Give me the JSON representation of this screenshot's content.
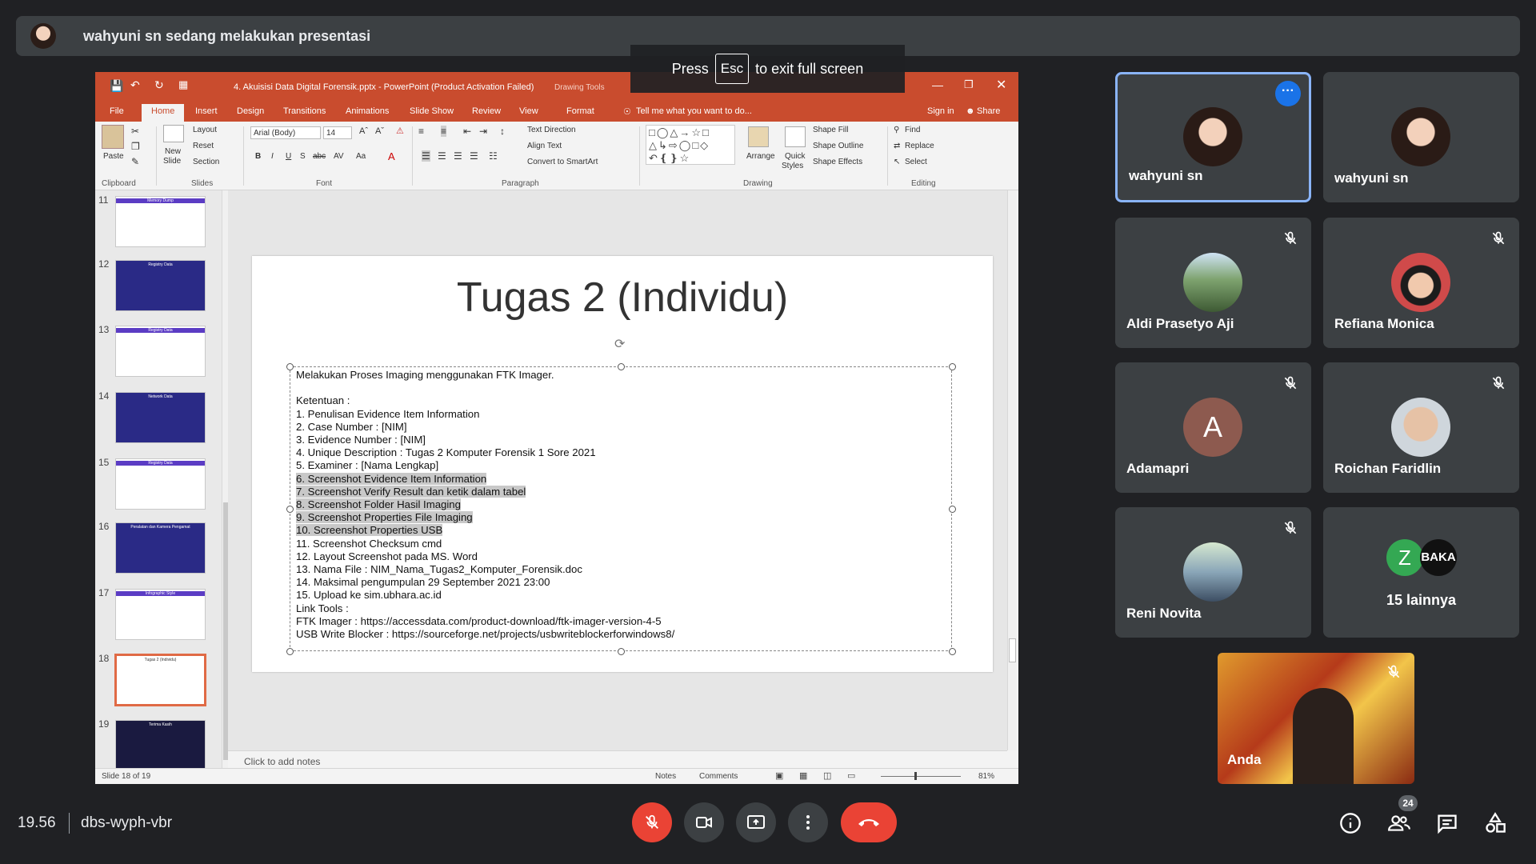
{
  "banner": {
    "text": "wahyuni sn sedang melakukan presentasi"
  },
  "esc_overlay": {
    "press": "Press",
    "key": "Esc",
    "suffix": "to exit full screen"
  },
  "ppt": {
    "window_title": "4. Akuisisi Data Digital Forensik.pptx - PowerPoint (Product Activation Failed)",
    "context_tab_title": "Drawing Tools",
    "tabs": [
      "File",
      "Home",
      "Insert",
      "Design",
      "Transitions",
      "Animations",
      "Slide Show",
      "Review",
      "View",
      "Format"
    ],
    "tell_me": "Tell me what you want to do...",
    "sign_in": "Sign in",
    "share": "Share",
    "ribbon": {
      "paste": "Paste",
      "clipboard": "Clipboard",
      "new_slide_1": "New",
      "new_slide_2": "Slide",
      "layout": "Layout",
      "reset": "Reset",
      "section": "Section",
      "slides": "Slides",
      "font_name": "Arial (Body)",
      "font_size": "14",
      "font": "Font",
      "text_direction": "Text Direction",
      "align_text": "Align Text",
      "convert_smartart": "Convert to SmartArt",
      "paragraph": "Paragraph",
      "arrange": "Arrange",
      "quick_styles_1": "Quick",
      "quick_styles_2": "Styles",
      "shape_fill": "Shape Fill",
      "shape_outline": "Shape Outline",
      "shape_effects": "Shape Effects",
      "drawing": "Drawing",
      "find": "Find",
      "replace": "Replace",
      "select": "Select",
      "editing": "Editing"
    },
    "thumbnails": [
      {
        "num": "11",
        "caption": "Memory Dump",
        "bg": "#ffffff"
      },
      {
        "num": "12",
        "caption": "Registry Data",
        "bg": "#2a2a86"
      },
      {
        "num": "13",
        "caption": "Registry Data",
        "bg": "#ffffff"
      },
      {
        "num": "14",
        "caption": "Network Data",
        "bg": "#2a2a86"
      },
      {
        "num": "15",
        "caption": "Registry Data",
        "bg": "#ffffff"
      },
      {
        "num": "16",
        "caption": "Peralatan dan Kamera Pengamat",
        "bg": "#2a2a86"
      },
      {
        "num": "17",
        "caption": "Infographic Style",
        "bg": "#ffffff"
      },
      {
        "num": "18",
        "caption": "Tugas 2 (Individu)",
        "bg": "#ffffff"
      },
      {
        "num": "19",
        "caption": "Terima Kasih",
        "bg": "#1a1a40"
      }
    ],
    "slide": {
      "title": "Tugas 2 (Individu)",
      "lines": [
        {
          "text": "Melakukan Proses Imaging menggunakan FTK Imager.",
          "hl": false
        },
        {
          "text": "",
          "hl": false
        },
        {
          "text": "Ketentuan :",
          "hl": false
        },
        {
          "text": "1.    Penulisan Evidence Item Information",
          "hl": false
        },
        {
          "text": "2.    Case Number : [NIM]",
          "hl": false
        },
        {
          "text": "3.    Evidence Number : [NIM]",
          "hl": false
        },
        {
          "text": "4.    Unique Description : Tugas 2 Komputer Forensik 1 Sore 2021",
          "hl": false
        },
        {
          "text": "5.    Examiner : [Nama Lengkap]",
          "hl": false
        },
        {
          "text": "6.    Screenshot Evidence Item Information",
          "hl": true
        },
        {
          "text": "7.    Screenshot Verify Result dan ketik dalam tabel",
          "hl": true
        },
        {
          "text": "8.    Screenshot Folder Hasil Imaging",
          "hl": true
        },
        {
          "text": "9.    Screenshot Properties File Imaging",
          "hl": true
        },
        {
          "text": "10.   Screenshot Properties USB",
          "hl": true
        },
        {
          "text": "11.   Screenshot Checksum cmd",
          "hl": false
        },
        {
          "text": "12.   Layout Screenshot pada MS. Word",
          "hl": false
        },
        {
          "text": "13.   Nama File : NIM_Nama_Tugas2_Komputer_Forensik.doc",
          "hl": false
        },
        {
          "text": "14.   Maksimal pengumpulan 29 September 2021 23:00",
          "hl": false
        },
        {
          "text": "15.   Upload ke sim.ubhara.ac.id",
          "hl": false
        },
        {
          "text": "Link Tools :",
          "hl": false
        },
        {
          "text": "FTK Imager : https://accessdata.com/product-download/ftk-imager-version-4-5",
          "hl": false
        },
        {
          "text": "USB Write Blocker : https://sourceforge.net/projects/usbwriteblockerforwindows8/",
          "hl": false
        }
      ]
    },
    "notes_placeholder": "Click to add notes",
    "status": {
      "slide_of": "Slide 18 of 19",
      "notes": "Notes",
      "comments": "Comments",
      "zoom": "81%"
    }
  },
  "participants": [
    {
      "name": "wahyuni sn",
      "muted": false,
      "active": true,
      "pic": "face-woman"
    },
    {
      "name": "wahyuni sn",
      "muted": false,
      "active": false,
      "pic": "face-woman"
    },
    {
      "name": "Aldi Prasetyo Aji",
      "muted": true,
      "active": false,
      "pic": "landscape"
    },
    {
      "name": "Refiana Monica",
      "muted": true,
      "active": false,
      "pic": "face-girl"
    },
    {
      "name": "Adamapri",
      "muted": true,
      "active": false,
      "pic": "letter",
      "letter": "A",
      "letter_bg": "#8d5a4f"
    },
    {
      "name": "Roichan Faridlin",
      "muted": true,
      "active": false,
      "pic": "face-man"
    },
    {
      "name": "Reni Novita",
      "muted": true,
      "active": false,
      "pic": "outdoor"
    }
  ],
  "more_tile": {
    "avatar_z": "Z",
    "avatar_baka": "BAKA",
    "label": "15 lainnya"
  },
  "self_tile": {
    "name": "Anda"
  },
  "bottom": {
    "time": "19.56",
    "meeting_code": "dbs-wyph-vbr",
    "participant_count": "24"
  },
  "colors": {
    "ppt_accent": "#c94c2e",
    "meet_bg": "#202124",
    "tile_bg": "#3c4043",
    "active_border": "#8ab4f8",
    "red": "#ea4335"
  }
}
